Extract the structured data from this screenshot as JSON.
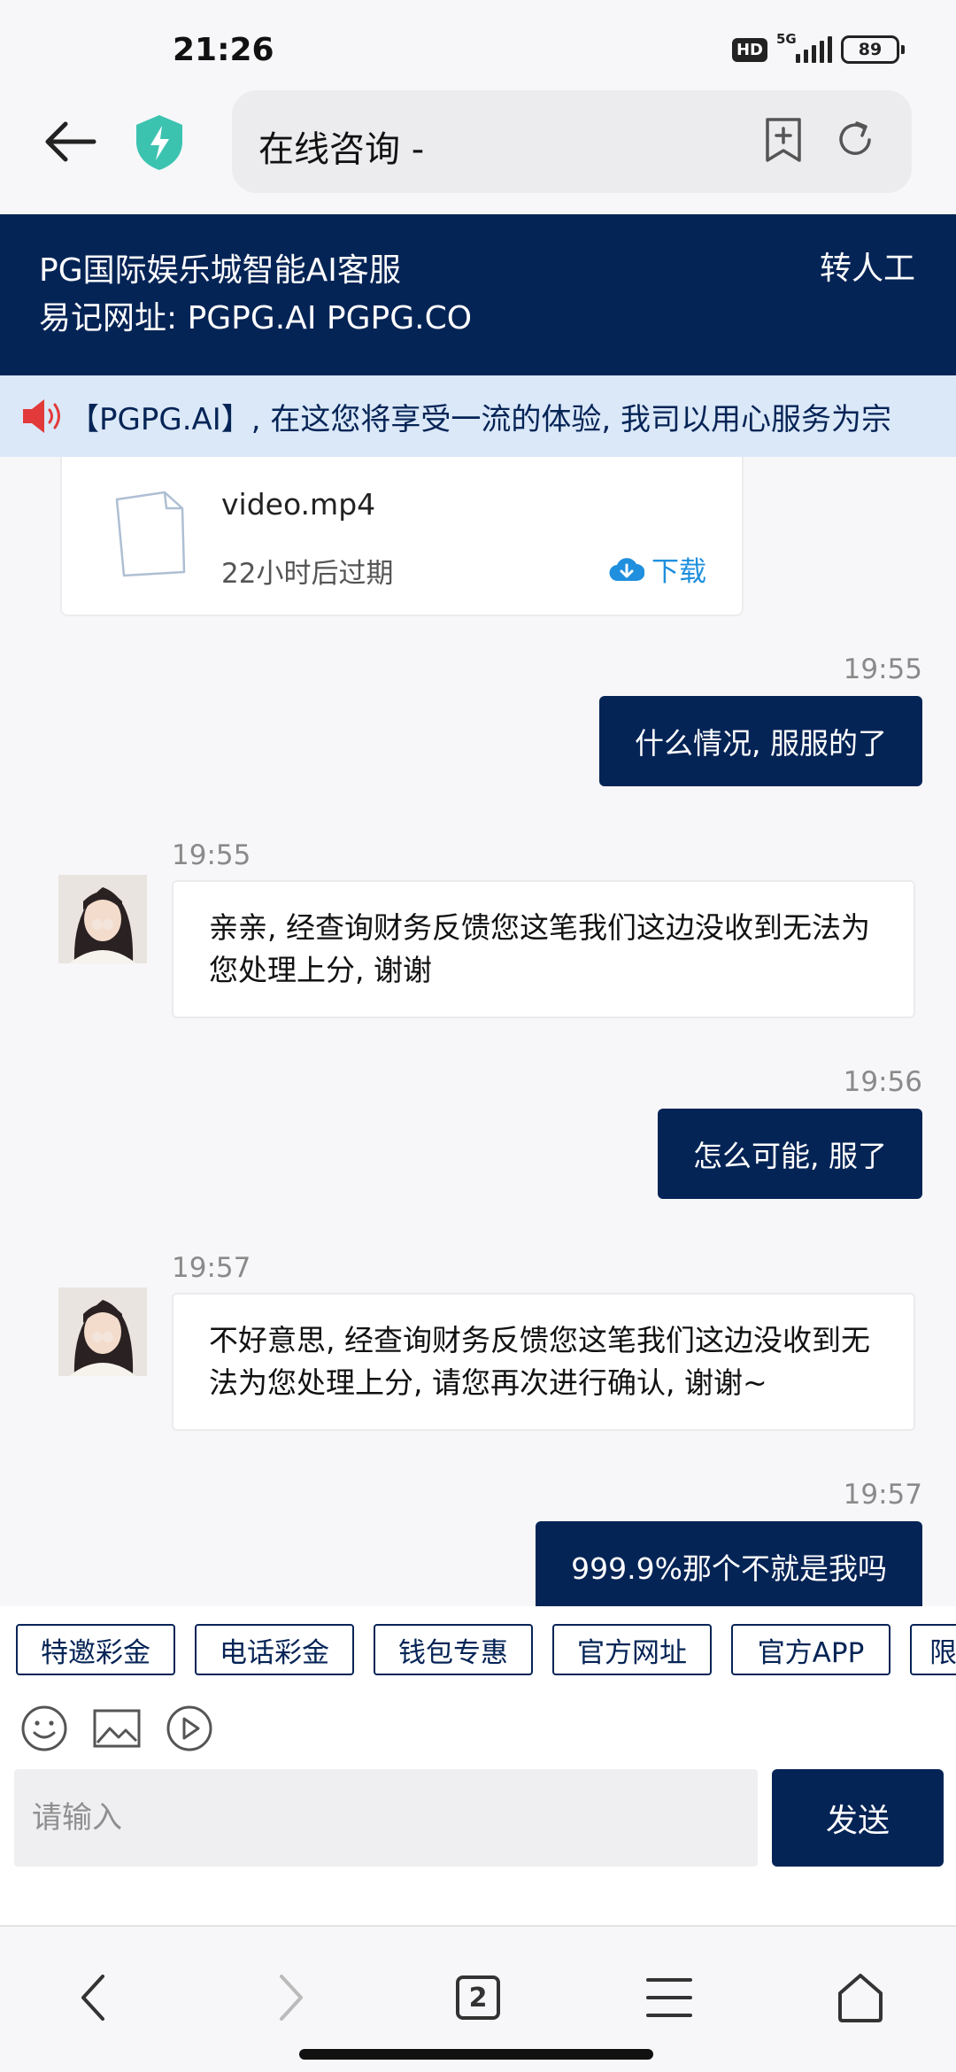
{
  "status_bar": {
    "time": "21:26",
    "hd_label": "HD",
    "network": "5G",
    "battery": "89"
  },
  "browser": {
    "url_title": "在线咨询 -",
    "icons": [
      "back-arrow-icon",
      "security-shield-icon",
      "add-bookmark-icon",
      "refresh-icon"
    ]
  },
  "header": {
    "title": "PG国际娱乐城智能AI客服",
    "subtitle": "易记网址: PGPG.AI PGPG.CO",
    "transfer_label": "转人工",
    "bg_color": "#052456"
  },
  "notice": {
    "text": "【PGPG.AI】, 在这您将享受一流的体验, 我司以用心服务为宗"
  },
  "chat": {
    "file": {
      "name": "video.mp4",
      "expire": "22小时后过期",
      "download_label": "下载"
    },
    "messages": [
      {
        "time": "19:55",
        "from": "user",
        "text": "什么情况, 服服的了"
      },
      {
        "time": "19:55",
        "from": "agent",
        "text": "亲亲, 经查询财务反馈您这笔我们这边没收到无法为您处理上分, 谢谢"
      },
      {
        "time": "19:56",
        "from": "user",
        "text": "怎么可能, 服了"
      },
      {
        "time": "19:57",
        "from": "agent",
        "text": "不好意思, 经查询财务反馈您这笔我们这边没收到无法为您处理上分, 请您再次进行确认, 谢谢~"
      },
      {
        "time": "19:57",
        "from": "user",
        "text": "999.9%那个不就是我吗"
      }
    ]
  },
  "quick_tags": [
    "特邀彩金",
    "电话彩金",
    "钱包专惠",
    "官方网址",
    "官方APP",
    "限"
  ],
  "input": {
    "placeholder": "请输入",
    "send_label": "发送"
  },
  "bottom_nav": {
    "tab_count": "2"
  }
}
